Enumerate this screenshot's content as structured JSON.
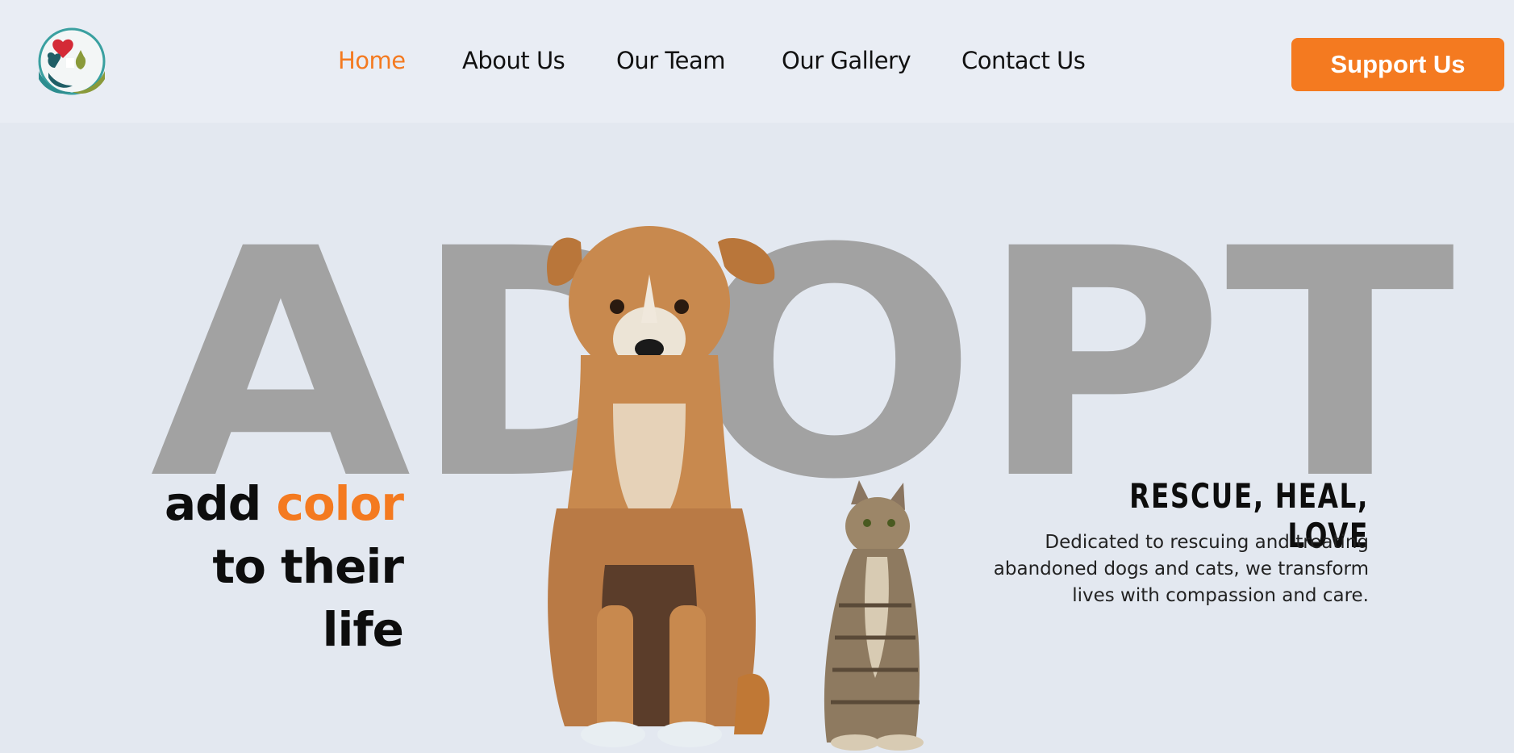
{
  "header": {
    "logo_name": "rescue-logo",
    "nav": [
      {
        "label": "Home",
        "active": true
      },
      {
        "label": "About Us",
        "active": false
      },
      {
        "label": "Our Team",
        "active": false
      },
      {
        "label": "Our Gallery",
        "active": false
      },
      {
        "label": "Contact Us",
        "active": false
      }
    ],
    "support_label": "Support Us"
  },
  "hero": {
    "big_word": "ADOPT",
    "tagline": {
      "line1_part1": "add",
      "line1_part2": "color",
      "line2": "to their",
      "line3": "life"
    },
    "photo_subject": "dog-and-cat-photo",
    "title": "RESCUE, HEAL, LOVE",
    "description": "Dedicated to rescuing and treating abandoned dogs and cats, we transform lives with compassion and care."
  },
  "colors": {
    "accent": "#f47a20",
    "background": "#e3e8f0",
    "header_bg": "#e9edf4",
    "big_word": "#a2a2a2",
    "text": "#0d0d0d"
  }
}
